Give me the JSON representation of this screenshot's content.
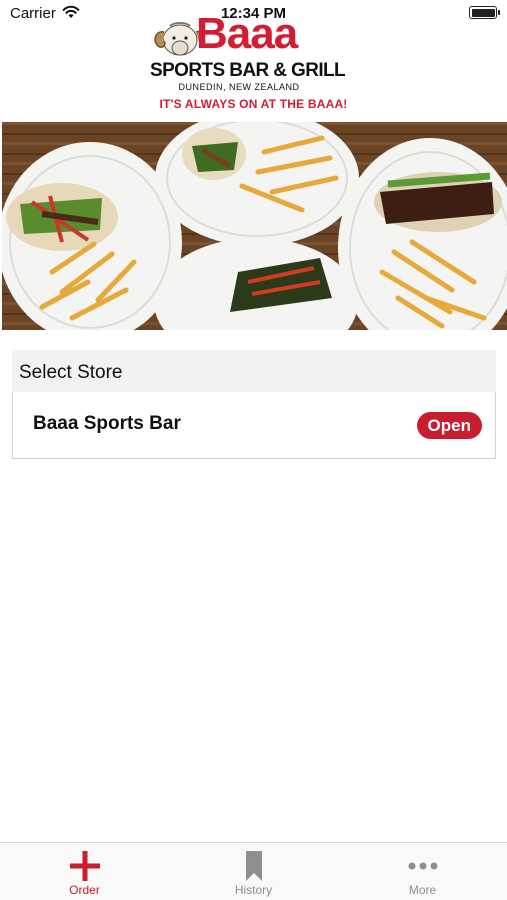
{
  "status_bar": {
    "carrier": "Carrier",
    "time": "12:34 PM"
  },
  "logo": {
    "wordmark": "Baaa",
    "subtitle": "SPORTS BAR & GRILL",
    "location": "DUNEDIN, NEW ZEALAND",
    "tagline": "IT'S ALWAYS ON AT THE BAAA!"
  },
  "store_section": {
    "header": "Select Store",
    "stores": [
      {
        "name": "Baaa Sports Bar",
        "status": "Open"
      }
    ]
  },
  "tab_bar": {
    "tabs": [
      {
        "label": "Order",
        "icon": "plus-icon",
        "active": true
      },
      {
        "label": "History",
        "icon": "bookmark-icon",
        "active": false
      },
      {
        "label": "More",
        "icon": "ellipsis-icon",
        "active": false
      }
    ]
  },
  "colors": {
    "brand_red": "#c81c30",
    "inactive_gray": "#8e8e93"
  }
}
